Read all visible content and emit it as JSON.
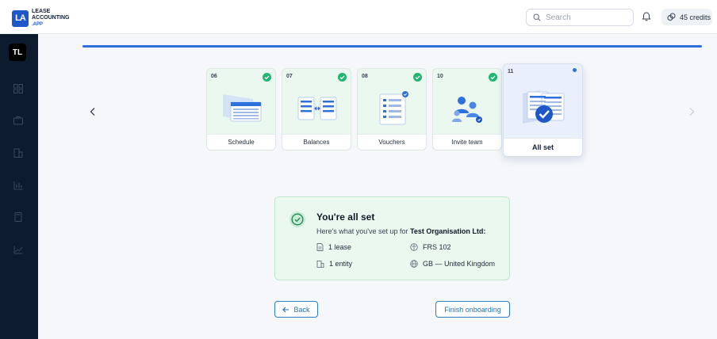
{
  "brand": {
    "logo_mark": "LA",
    "line1": "LEASE",
    "line2": "ACCOUNTING",
    "line3": ".APP"
  },
  "header": {
    "search_placeholder": "Search",
    "credits_label": "45 credits"
  },
  "sidebar": {
    "avatar_initials": "TL",
    "icons": [
      "grid-icon",
      "briefcase-icon",
      "building-icon",
      "bar-chart-icon",
      "calculator-icon",
      "line-chart-icon"
    ]
  },
  "progress": {
    "fraction": 1.0
  },
  "steps": [
    {
      "num": "06",
      "label": "Schedule",
      "status": "done"
    },
    {
      "num": "07",
      "label": "Balances",
      "status": "done"
    },
    {
      "num": "08",
      "label": "Vouchers",
      "status": "done"
    },
    {
      "num": "10",
      "label": "Invite team",
      "status": "done"
    },
    {
      "num": "11",
      "label": "All set",
      "status": "current"
    }
  ],
  "summary": {
    "title": "You're all set",
    "subtitle_prefix": "Here's what you've set up for ",
    "organisation": "Test Organisation Ltd:",
    "items": {
      "leases": "1 lease",
      "standard": "FRS 102",
      "entities": "1 entity",
      "country": "GB — United Kingdom"
    }
  },
  "actions": {
    "back_label": "Back",
    "finish_label": "Finish onboarding"
  },
  "colors": {
    "primary": "#2d6fdb",
    "success": "#22b573",
    "sidebar": "#0d1b2f"
  }
}
